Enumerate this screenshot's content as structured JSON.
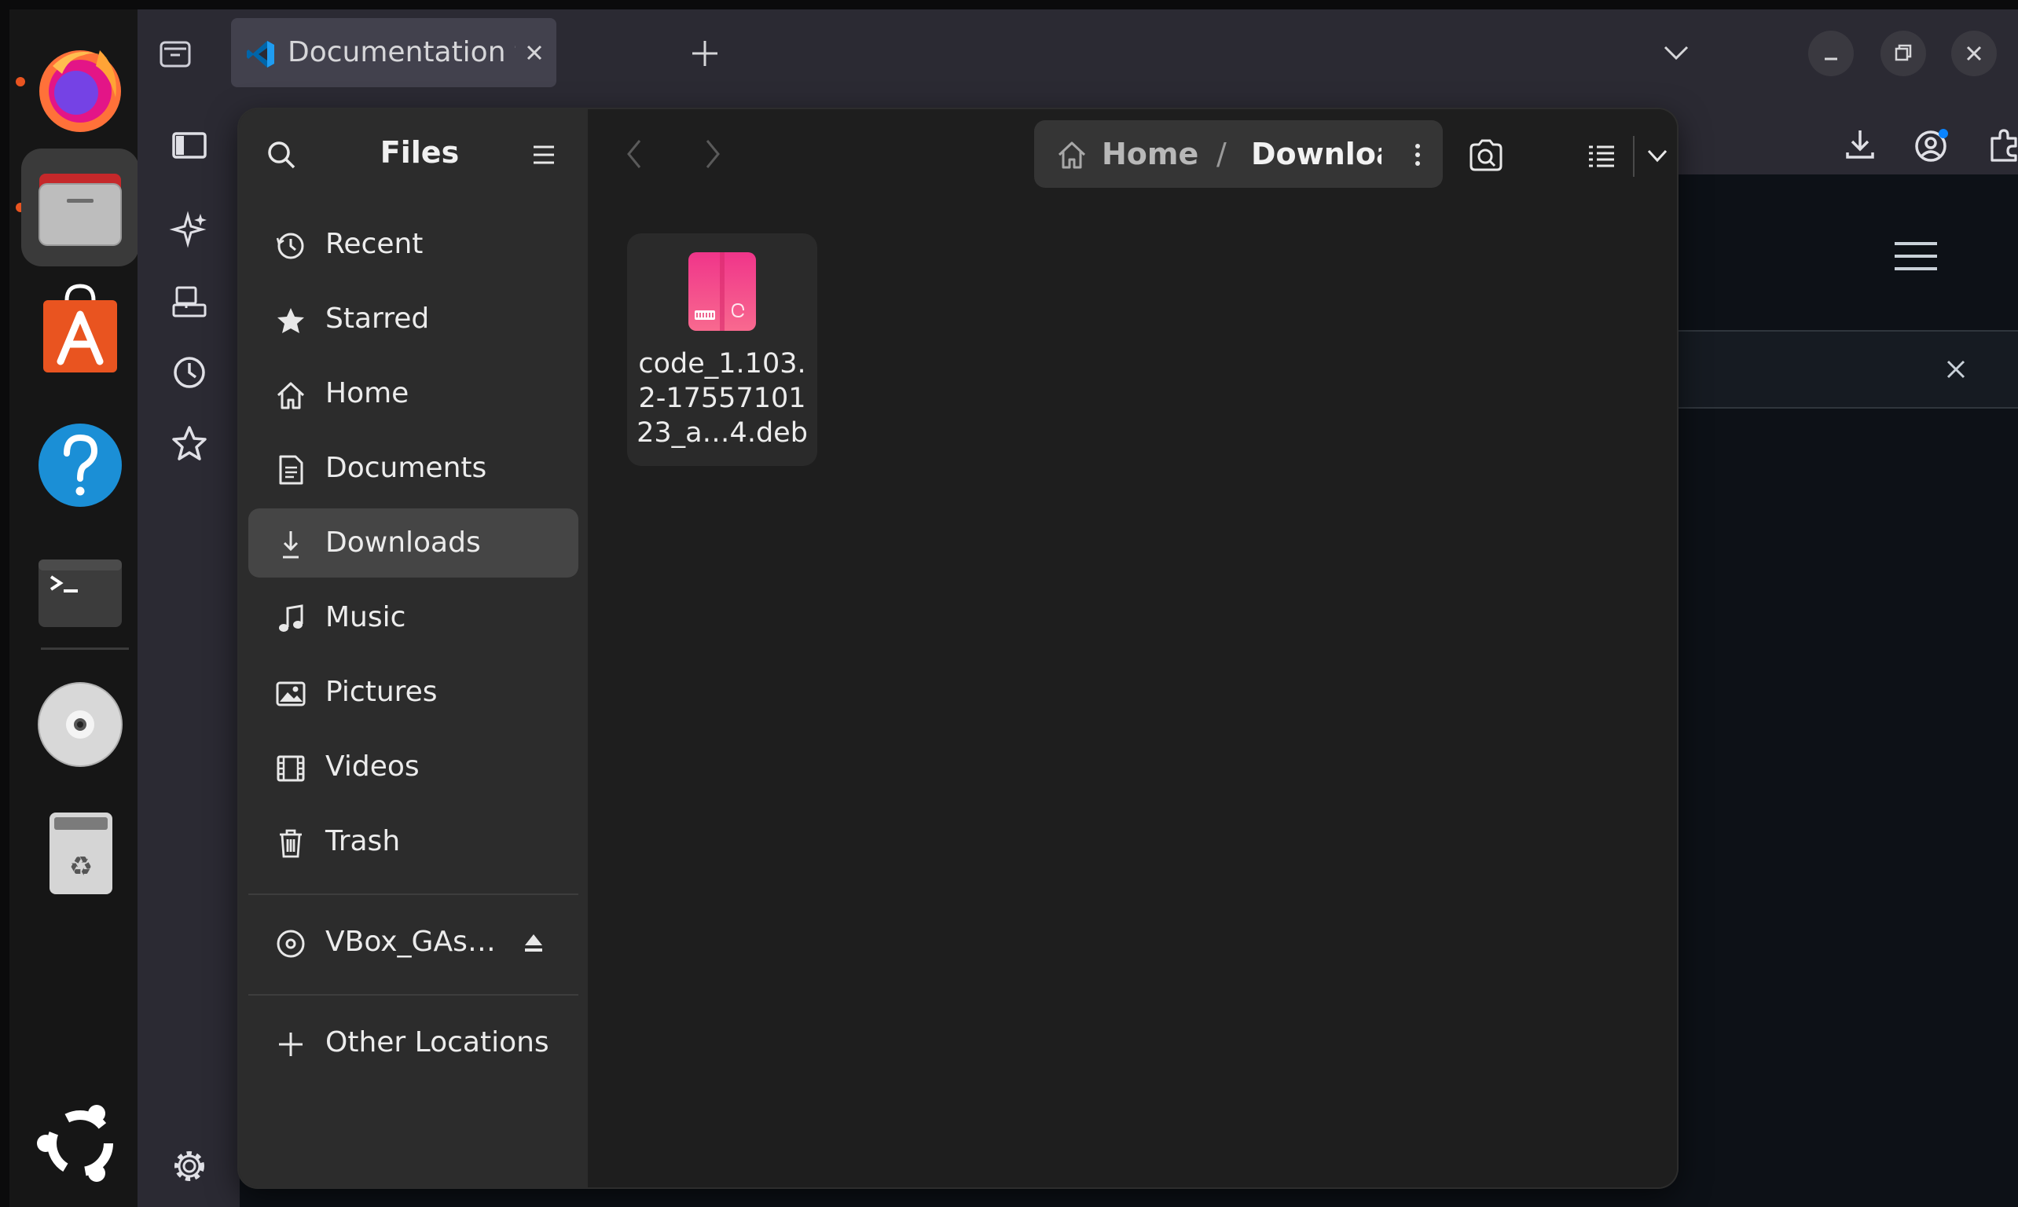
{
  "browser": {
    "tab_title": "Documentation for Visual",
    "accent_color": "#0a84ff"
  },
  "files": {
    "sidebar_title": "Files",
    "places": [
      {
        "label": "Recent",
        "icon": "clock-icon"
      },
      {
        "label": "Starred",
        "icon": "star-icon"
      },
      {
        "label": "Home",
        "icon": "home-icon"
      },
      {
        "label": "Documents",
        "icon": "document-icon"
      },
      {
        "label": "Downloads",
        "icon": "download-icon",
        "selected": true
      },
      {
        "label": "Music",
        "icon": "music-note-icon"
      },
      {
        "label": "Pictures",
        "icon": "picture-icon"
      },
      {
        "label": "Videos",
        "icon": "film-icon"
      },
      {
        "label": "Trash",
        "icon": "trash-icon"
      }
    ],
    "devices": [
      {
        "label": "VBox_GAs…",
        "icon": "disc-icon"
      }
    ],
    "other_locations": "Other Locations",
    "path": {
      "home": "Home",
      "separator": "/",
      "current": "Downloac"
    },
    "items": [
      {
        "name": "code_1.103.\n2-17557101\n23_a…4.deb",
        "icon": "debian-package-icon",
        "color": "#e8336d"
      }
    ]
  }
}
